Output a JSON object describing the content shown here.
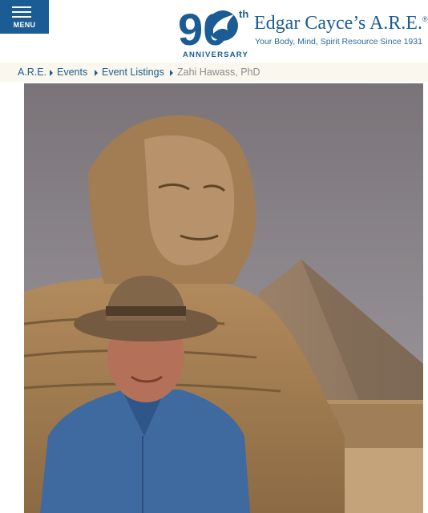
{
  "menu": {
    "label": "MENU"
  },
  "logo": {
    "number": "90",
    "ordinal": "th",
    "anniversary": "ANNIVERSARY",
    "brand": "Edgar Cayce’s A.R.E.",
    "registered": "®",
    "tagline": "Your Body, Mind, Spirit Resource Since 1931"
  },
  "breadcrumb": {
    "items": [
      "A.R.E.",
      "Events",
      "Event Listings"
    ],
    "current": "Zahi Hawass, PhD"
  },
  "colors": {
    "brand_blue": "#1b5c94",
    "crumb_bg": "#faf8ee"
  },
  "hero": {
    "subject": "photo-person-hat-sphinx-pyramid"
  }
}
